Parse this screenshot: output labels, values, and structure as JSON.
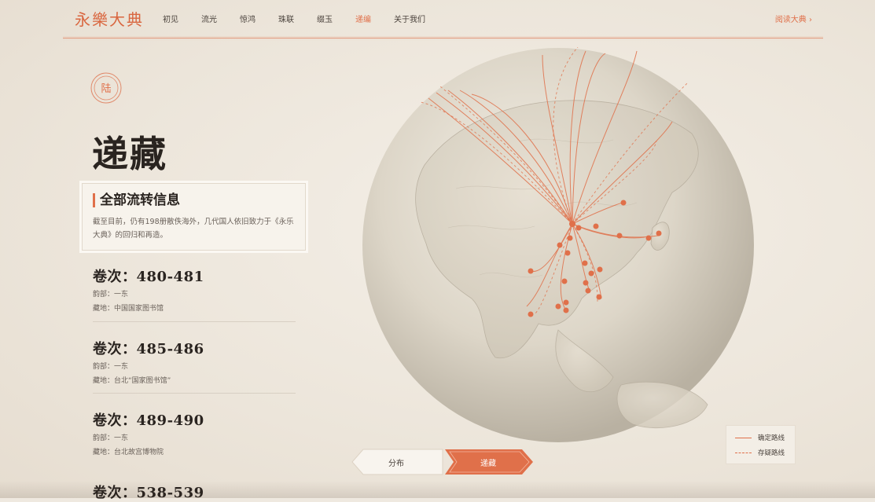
{
  "header": {
    "logo": "永樂大典",
    "nav": [
      "初见",
      "流光",
      "惊鸿",
      "珠联",
      "缀玉",
      "递编",
      "关于我们"
    ],
    "active_index": 5,
    "read_link": "阅读大典 ›"
  },
  "section": {
    "badge": "陆",
    "title": "递藏"
  },
  "info": {
    "title": "全部流转信息",
    "text": "截至目前，仍有198册散佚海外，几代国人依旧致力于《永乐大典》的回归和再造。"
  },
  "volumes": [
    {
      "title": "卷次：480-481",
      "rhyme": "韵部：一东",
      "place": "藏地：中国国家图书馆"
    },
    {
      "title": "卷次：485-486",
      "rhyme": "韵部：一东",
      "place": "藏地：台北“国家图书馆”"
    },
    {
      "title": "卷次：489-490",
      "rhyme": "韵部：一东",
      "place": "藏地：台北故宫博物院"
    },
    {
      "title": "卷次：538-539",
      "rhyme": "",
      "place": ""
    }
  ],
  "legend": {
    "confirmed": "确定路线",
    "doubtful": "存疑路线"
  },
  "toggle": {
    "left": "分布",
    "right": "递藏",
    "active": "right"
  },
  "colors": {
    "accent": "#e0704a",
    "background": "#efe9e0",
    "text": "#2a2420"
  }
}
